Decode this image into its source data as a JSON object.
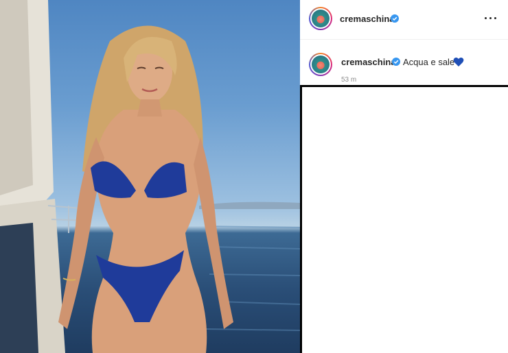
{
  "post": {
    "username": "cremaschina",
    "verified": true,
    "caption": {
      "username": "cremaschina",
      "text": "Acqua e sale",
      "emoji": "blue-heart",
      "time": "53 m"
    },
    "photo": {
      "description_icon": "photo",
      "colors": {
        "sky": "#6a9dd0",
        "sea": "#2a4e77",
        "bikini": "#1f3b9a",
        "skin": "#d9a07a",
        "hair": "#d8b378"
      }
    }
  },
  "colors": {
    "verified_blue": "#3897f0",
    "text_primary": "#262626",
    "text_secondary": "#8e8e8e",
    "heart_blue": "#1f4fb6"
  }
}
